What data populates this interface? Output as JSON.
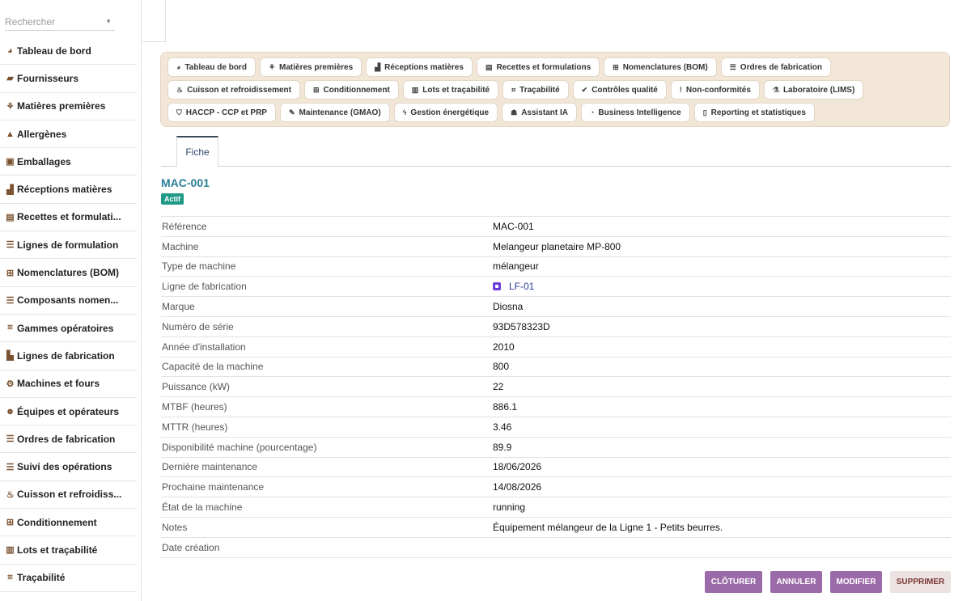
{
  "search": {
    "placeholder": "Rechercher"
  },
  "sidebar": {
    "items": [
      {
        "icon": "dashboard-icon",
        "glyph": "◕",
        "label": "Tableau de bord"
      },
      {
        "icon": "truck-icon",
        "glyph": "▰",
        "label": "Fournisseurs"
      },
      {
        "icon": "seedling-icon",
        "glyph": "⚘",
        "label": "Matières premières"
      },
      {
        "icon": "warning-icon",
        "glyph": "▲",
        "label": "Allergènes"
      },
      {
        "icon": "box-icon",
        "glyph": "▣",
        "label": "Emballages"
      },
      {
        "icon": "truck-loading-icon",
        "glyph": "▟",
        "label": "Réceptions matières"
      },
      {
        "icon": "book-icon",
        "glyph": "▤",
        "label": "Recettes et formulati..."
      },
      {
        "icon": "list-icon",
        "glyph": "☰",
        "label": "Lignes de formulation"
      },
      {
        "icon": "sitemap-icon",
        "glyph": "⊞",
        "label": "Nomenclatures (BOM)"
      },
      {
        "icon": "list-icon",
        "glyph": "☰",
        "label": "Composants nomen..."
      },
      {
        "icon": "route-icon",
        "glyph": "⌗",
        "label": "Gammes opératoires"
      },
      {
        "icon": "industry-icon",
        "glyph": "▙",
        "label": "Lignes de fabrication"
      },
      {
        "icon": "cogs-icon",
        "glyph": "⚙",
        "label": "Machines et fours"
      },
      {
        "icon": "users-icon",
        "glyph": "☻",
        "label": "Équipes et opérateurs"
      },
      {
        "icon": "list-icon",
        "glyph": "☰",
        "label": "Ordres de fabrication"
      },
      {
        "icon": "list-icon",
        "glyph": "☰",
        "label": "Suivi des opérations"
      },
      {
        "icon": "fire-icon",
        "glyph": "♨",
        "label": "Cuisson et refroidiss..."
      },
      {
        "icon": "boxes-icon",
        "glyph": "⊞",
        "label": "Conditionnement"
      },
      {
        "icon": "barcode-icon",
        "glyph": "▥",
        "label": "Lots et traçabilité"
      },
      {
        "icon": "route-icon",
        "glyph": "⌗",
        "label": "Traçabilité"
      }
    ]
  },
  "modules": [
    {
      "icon": "dashboard-icon",
      "glyph": "◕",
      "label": "Tableau de bord"
    },
    {
      "icon": "seedling-icon",
      "glyph": "⚘",
      "label": "Matières premières"
    },
    {
      "icon": "truck-loading-icon",
      "glyph": "▟",
      "label": "Réceptions matières"
    },
    {
      "icon": "book-icon",
      "glyph": "▤",
      "label": "Recettes et formulations"
    },
    {
      "icon": "sitemap-icon",
      "glyph": "⊞",
      "label": "Nomenclatures (BOM)"
    },
    {
      "icon": "list-icon",
      "glyph": "☰",
      "label": "Ordres de fabrication"
    },
    {
      "icon": "fire-icon",
      "glyph": "♨",
      "label": "Cuisson et refroidissement"
    },
    {
      "icon": "boxes-icon",
      "glyph": "⊞",
      "label": "Conditionnement"
    },
    {
      "icon": "barcode-icon",
      "glyph": "▥",
      "label": "Lots et traçabilité"
    },
    {
      "icon": "route-icon",
      "glyph": "⌗",
      "label": "Traçabilité"
    },
    {
      "icon": "check-circle-icon",
      "glyph": "✔",
      "label": "Contrôles qualité"
    },
    {
      "icon": "exclamation-circle-icon",
      "glyph": "!",
      "label": "Non-conformités"
    },
    {
      "icon": "flask-icon",
      "glyph": "⚗",
      "label": "Laboratoire (LIMS)"
    },
    {
      "icon": "shield-icon",
      "glyph": "⛉",
      "label": "HACCP - CCP et PRP"
    },
    {
      "icon": "wrench-icon",
      "glyph": "✎",
      "label": "Maintenance (GMAO)"
    },
    {
      "icon": "bolt-icon",
      "glyph": "ϟ",
      "label": "Gestion énergétique"
    },
    {
      "icon": "robot-icon",
      "glyph": "☗",
      "label": "Assistant IA"
    },
    {
      "icon": "chart-pie-icon",
      "glyph": "◔",
      "label": "Business Intelligence"
    },
    {
      "icon": "file-icon",
      "glyph": "▯",
      "label": "Reporting et statistiques"
    }
  ],
  "tabs": {
    "fiche": "Fiche"
  },
  "record": {
    "title": "MAC-001",
    "status": "Actif",
    "status_color": "#1f9a86",
    "fields": [
      {
        "label": "Référence",
        "value": "MAC-001"
      },
      {
        "label": "Machine",
        "value": "Melangeur planetaire MP-800"
      },
      {
        "label": "Type de machine",
        "value": "mélangeur"
      },
      {
        "label": "Ligne de fabrication",
        "value": "LF-01",
        "link": true
      },
      {
        "label": "Marque",
        "value": "Diosna"
      },
      {
        "label": "Numéro de série",
        "value": "93D578323D"
      },
      {
        "label": "Année d'installation",
        "value": "2010"
      },
      {
        "label": "Capacité de la machine",
        "value": "800"
      },
      {
        "label": "Puissance (kW)",
        "value": "22"
      },
      {
        "label": "MTBF (heures)",
        "value": "886.1"
      },
      {
        "label": "MTTR (heures)",
        "value": "3.46"
      },
      {
        "label": "Disponibilité machine (pourcentage)",
        "value": "89.9"
      },
      {
        "label": "Dernière maintenance",
        "value": "18/06/2026"
      },
      {
        "label": "Prochaine maintenance",
        "value": "14/08/2026"
      },
      {
        "label": "État de la machine",
        "value": "running"
      },
      {
        "label": "Notes",
        "value": "Équipement mélangeur de la Ligne 1 - Petits beurres."
      },
      {
        "label": "Date création",
        "value": ""
      }
    ]
  },
  "actions": {
    "cloturer": "CLÔTURER",
    "annuler": "ANNULER",
    "modifier": "MODIFIER",
    "supprimer": "SUPPRIMER"
  },
  "colors": {
    "accent": "#9b6aa8",
    "title": "#2a7f94",
    "modbar_bg": "#f2e6d7"
  }
}
